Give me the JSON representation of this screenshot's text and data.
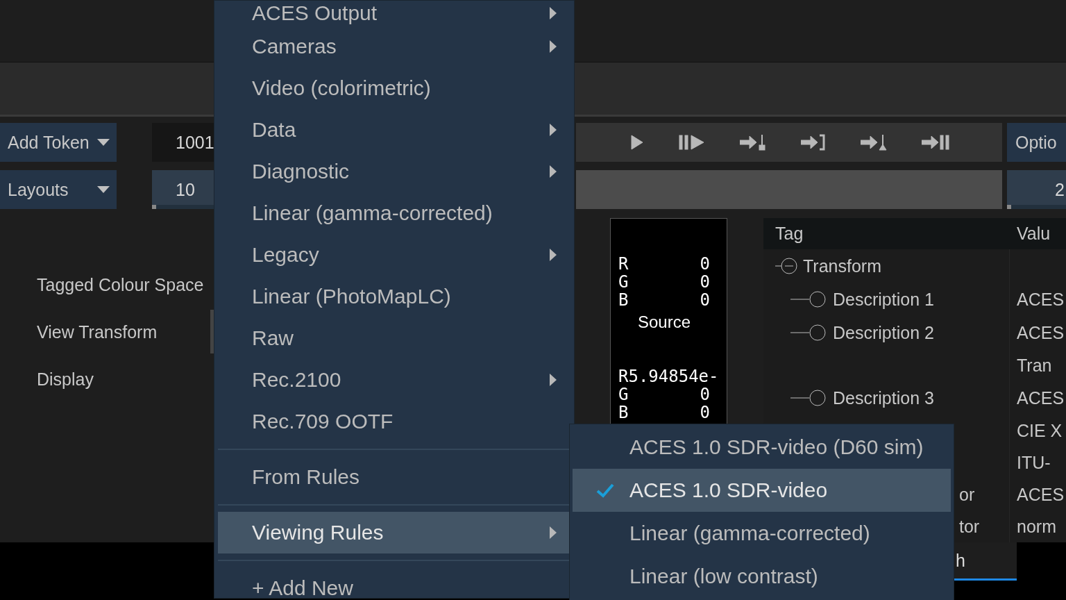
{
  "toolbar": {
    "row_1": {
      "menu_button": "Add Token",
      "field": "1001",
      "side_button": "Optio"
    },
    "row_2": {
      "menu_button": "Layouts",
      "field": {
        "text": "10",
        "level": 0.02
      },
      "side_field": {
        "text": "2",
        "level": 0.02
      }
    }
  },
  "colour_panel": {
    "labels": [
      "Tagged Colour Space",
      "View Transform",
      "Display"
    ]
  },
  "pixel_inspector": {
    "blocks": [
      {
        "rows": [
          {
            "channel": "R",
            "value": "0"
          },
          {
            "channel": "G",
            "value": "0"
          },
          {
            "channel": "B",
            "value": "0"
          }
        ],
        "caption": "Source"
      },
      {
        "rows": [
          {
            "channel": "R",
            "value": "5.94854e-"
          },
          {
            "channel": "G",
            "value": "0"
          },
          {
            "channel": "B",
            "value": "0"
          }
        ]
      }
    ]
  },
  "table": {
    "columns": [
      "Tag",
      "Valu"
    ],
    "rows": [
      {
        "tag": "Transform",
        "expanded": true,
        "children": [
          {
            "tag": "Description 1",
            "value": "ACES"
          },
          {
            "tag": "Description 2",
            "value": "ACES"
          },
          {
            "value": "Tran"
          },
          {
            "tag": "Description 3",
            "value": "ACES"
          },
          {
            "value": "CIE X"
          },
          {
            "value": "ITU-"
          },
          {
            "tag": "or",
            "value": "ACES",
            "kind": "clipped"
          },
          {
            "tag": "tor",
            "value": "norm",
            "kind": "clipped"
          }
        ]
      }
    ]
  },
  "bottom_tabs": [
    {
      "label": "h",
      "selected": true
    }
  ],
  "menu": {
    "items": [
      {
        "kind": "item",
        "label": "ACES Output",
        "submenu": true,
        "selected": false
      },
      {
        "kind": "item",
        "label": "Cameras",
        "submenu": true,
        "selected": false
      },
      {
        "kind": "item",
        "label": "Video (colorimetric)",
        "submenu": false,
        "selected": false
      },
      {
        "kind": "item",
        "label": "Data",
        "submenu": true,
        "selected": false
      },
      {
        "kind": "item",
        "label": "Diagnostic",
        "submenu": true,
        "selected": false
      },
      {
        "kind": "item",
        "label": "Linear (gamma-corrected)",
        "submenu": false,
        "selected": false
      },
      {
        "kind": "item",
        "label": "Legacy",
        "submenu": true,
        "selected": false
      },
      {
        "kind": "item",
        "label": "Linear (PhotoMapLC)",
        "submenu": false,
        "selected": false
      },
      {
        "kind": "item",
        "label": "Raw",
        "submenu": false,
        "selected": false
      },
      {
        "kind": "item",
        "label": "Rec.2100",
        "submenu": true,
        "selected": false
      },
      {
        "kind": "item",
        "label": "Rec.709 OOTF",
        "submenu": false,
        "selected": false
      },
      {
        "kind": "separator"
      },
      {
        "kind": "item",
        "label": "From Rules",
        "submenu": false,
        "selected": false
      },
      {
        "kind": "separator"
      },
      {
        "kind": "item",
        "label": "Viewing Rules",
        "submenu": true,
        "selected": true
      },
      {
        "kind": "separator"
      },
      {
        "kind": "item",
        "label": "+ Add New",
        "submenu": false,
        "selected": false
      }
    ]
  },
  "submenu": {
    "items": [
      {
        "label": "ACES 1.0 SDR-video (D60 sim)",
        "checked": false,
        "selected": false
      },
      {
        "label": "ACES 1.0 SDR-video",
        "checked": true,
        "selected": true
      },
      {
        "label": "Linear (gamma-corrected)",
        "checked": false,
        "selected": false
      },
      {
        "label": "Linear (low contrast)",
        "checked": false,
        "selected": false
      }
    ]
  }
}
